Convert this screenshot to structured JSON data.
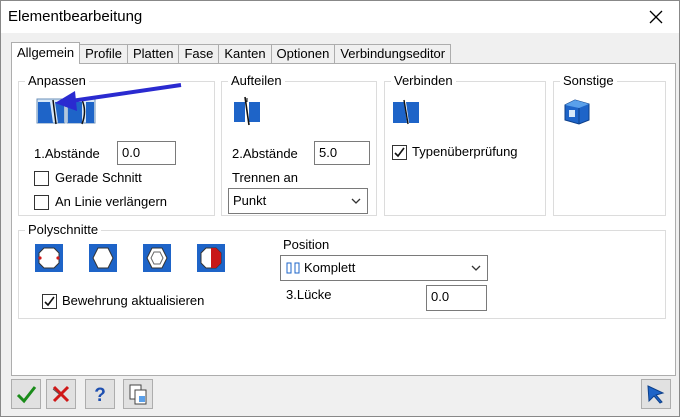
{
  "window": {
    "title": "Elementbearbeitung"
  },
  "tabs": [
    "Allgemein",
    "Profile",
    "Platten",
    "Fase",
    "Kanten",
    "Optionen",
    "Verbindungseditor"
  ],
  "anpassen": {
    "label": "Anpassen",
    "abstaende_label": "1.Abstände",
    "abstaende_value": "0.0",
    "gerade_schnitt_label": "Gerade Schnitt",
    "gerade_schnitt_checked": false,
    "linie_label": "An Linie verlängern",
    "linie_checked": false
  },
  "aufteilen": {
    "label": "Aufteilen",
    "abstaende_label": "2.Abstände",
    "abstaende_value": "5.0",
    "trennen_label": "Trennen an",
    "trennen_value": "Punkt"
  },
  "verbinden": {
    "label": "Verbinden",
    "typen_label": "Typenüberprüfung",
    "typen_checked": true
  },
  "sonstige": {
    "label": "Sonstige"
  },
  "polyschnitte": {
    "label": "Polyschnitte",
    "bewehrung_label": "Bewehrung aktualisieren",
    "bewehrung_checked": true,
    "position_label": "Position",
    "position_value": "Komplett",
    "luecke_label": "3.Lücke",
    "luecke_value": "0.0"
  },
  "icons": [
    "close-icon",
    "fit-cut-icon",
    "fit-bent-icon",
    "split-icon",
    "connect-icon",
    "cube-icon",
    "poly-octagon-icon",
    "poly-hexagon-icon",
    "poly-hexagon-beam-icon",
    "poly-octagon-red-icon",
    "ok-check-icon",
    "cancel-x-icon",
    "help-icon",
    "copy-page-icon",
    "pick-arrow-icon",
    "chevron-down-icon",
    "blue-arrow-annotation"
  ],
  "colors": {
    "accent_blue": "#1e64c8",
    "ok_green": "#1a8c1a",
    "cancel_red": "#d01818",
    "annotation_arrow": "#2a2ad0"
  }
}
